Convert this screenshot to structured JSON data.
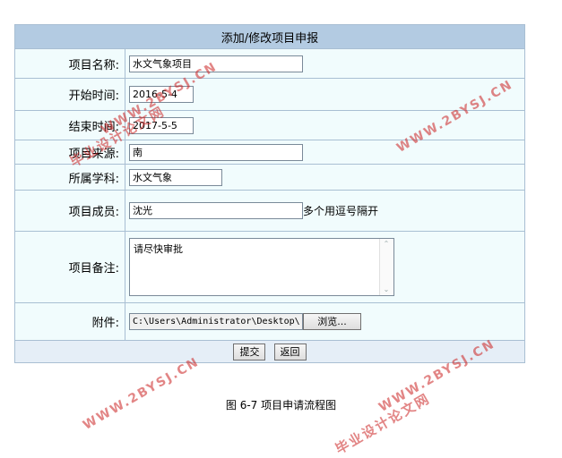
{
  "form": {
    "title": "添加/修改项目申报",
    "fields": {
      "name": {
        "label": "项目名称:",
        "value": "水文气象项目"
      },
      "start": {
        "label": "开始时间:",
        "value": "2016-5-4"
      },
      "end": {
        "label": "结束时间:",
        "value": "2017-5-5"
      },
      "source": {
        "label": "项目来源:",
        "value": "南"
      },
      "subject": {
        "label": "所属学科:",
        "value": "水文气象"
      },
      "members": {
        "label": "项目成员:",
        "value": "沈光",
        "hint": "多个用逗号隔开"
      },
      "remark": {
        "label": "项目备注:",
        "value": "请尽快审批"
      },
      "attachment": {
        "label": "附件:",
        "value": "C:\\Users\\Administrator\\Desktop\\",
        "browse_label": "浏览..."
      }
    },
    "submit_label": "提交",
    "back_label": "返回"
  },
  "caption": "图 6-7  项目申请流程图",
  "watermark": {
    "text": "WWW.2BYSJ.CN",
    "text2": "毕业设计论文网",
    "color": "#cc2222"
  }
}
